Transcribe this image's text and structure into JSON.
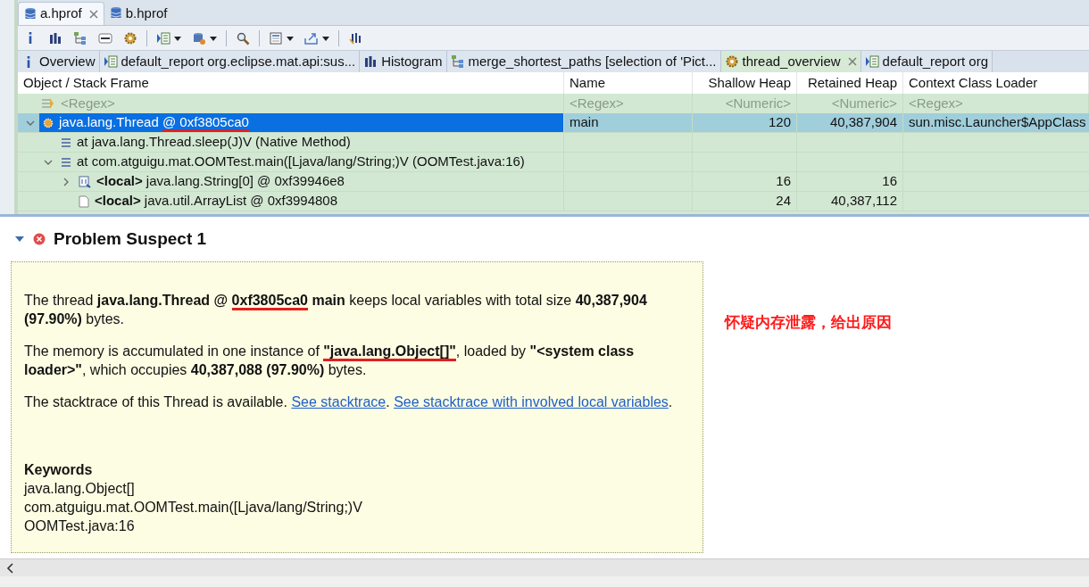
{
  "editor_tabs": [
    {
      "label": "a.hprof",
      "selected": true,
      "closable": true
    },
    {
      "label": "b.hprof",
      "selected": false,
      "closable": false
    }
  ],
  "toolbar": [
    {
      "kind": "info",
      "dropdown": false
    },
    {
      "kind": "histogram",
      "dropdown": false
    },
    {
      "kind": "tree",
      "dropdown": false
    },
    {
      "kind": "oql",
      "dropdown": false
    },
    {
      "kind": "gear",
      "dropdown": false
    },
    {
      "kind": "separator"
    },
    {
      "kind": "report",
      "dropdown": true
    },
    {
      "kind": "heap",
      "dropdown": true
    },
    {
      "kind": "separator"
    },
    {
      "kind": "search",
      "dropdown": false
    },
    {
      "kind": "separator"
    },
    {
      "kind": "calc",
      "dropdown": true
    },
    {
      "kind": "export",
      "dropdown": true
    },
    {
      "kind": "separator"
    },
    {
      "kind": "pin",
      "dropdown": false
    }
  ],
  "view_tabs": [
    {
      "kind": "info",
      "label": "Overview",
      "selected": false,
      "closable": false
    },
    {
      "kind": "report",
      "label": "default_report  org.eclipse.mat.api:sus...",
      "selected": false,
      "closable": false
    },
    {
      "kind": "histogram",
      "label": "Histogram",
      "selected": false,
      "closable": false
    },
    {
      "kind": "tree",
      "label": "merge_shortest_paths  [selection of 'Pict...",
      "selected": false,
      "closable": false
    },
    {
      "kind": "gear",
      "label": "thread_overview",
      "selected": true,
      "closable": true
    },
    {
      "kind": "report",
      "label": "default_report  org",
      "selected": false,
      "closable": false
    }
  ],
  "table": {
    "columns": [
      "Object / Stack Frame",
      "Name",
      "Shallow Heap",
      "Retained Heap",
      "Context Class Loader"
    ],
    "filters": [
      "<Regex>",
      "<Regex>",
      "<Numeric>",
      "<Numeric>",
      "<Regex>"
    ],
    "rows": [
      {
        "kind": "thread",
        "expanded": true,
        "selected": true,
        "object": [
          {
            "text": "java.lang.Thread "
          },
          {
            "text": "@ 0xf3805ca0",
            "marked": true
          }
        ],
        "name": "main",
        "shallow": "120",
        "retained": "40,387,904",
        "loader": "sun.misc.Launcher$AppClass",
        "children": [
          {
            "kind": "frame",
            "object": [
              {
                "text": "at java.lang.Thread.sleep(J)V (Native Method)"
              }
            ]
          },
          {
            "kind": "frame",
            "expanded": true,
            "object": [
              {
                "text": "at com.atguigu.mat.OOMTest.main([Ljava/lang/String;)V (OOMTest.java:16)"
              }
            ],
            "children": [
              {
                "kind": "array",
                "expanded": false,
                "object": [
                  {
                    "text": "<local>",
                    "bold": true
                  },
                  {
                    "text": " java.lang.String[0] @ 0xf39946e8"
                  }
                ],
                "shallow": "16",
                "retained": "16"
              },
              {
                "kind": "object",
                "object": [
                  {
                    "text": "<local>",
                    "bold": true
                  },
                  {
                    "text": " java.util.ArrayList @ 0xf3994808"
                  }
                ],
                "shallow": "24",
                "retained": "40,387,112"
              }
            ]
          }
        ]
      }
    ]
  },
  "suspect": {
    "title": "Problem Suspect 1",
    "expanded": true,
    "paragraphs": [
      [
        {
          "text": "The thread "
        },
        {
          "text": "java.lang.Thread @ ",
          "bold": true
        },
        {
          "text": "0xf3805ca0",
          "bold": true,
          "marked": true
        },
        {
          "text": " main",
          "bold": true
        },
        {
          "text": " keeps local variables with total size "
        },
        {
          "text": "40,387,904 (97.90%)",
          "bold": true
        },
        {
          "text": " bytes."
        }
      ],
      [
        {
          "text": "The memory is accumulated in one instance of "
        },
        {
          "text": "\"java.lang.Object[]\"",
          "bold": true,
          "marked": true
        },
        {
          "text": ", loaded by "
        },
        {
          "text": "\"<system class loader>\"",
          "bold": true
        },
        {
          "text": ", which occupies "
        },
        {
          "text": "40,387,088 (97.90%)",
          "bold": true
        },
        {
          "text": " bytes."
        }
      ],
      [
        {
          "text": "The stacktrace of this Thread is available. "
        },
        {
          "text": "See stacktrace",
          "link": true,
          "suffix": ". "
        },
        {
          "text": "See stacktrace with involved local variables",
          "link": true,
          "suffix": "."
        }
      ]
    ],
    "keywords_title": "Keywords",
    "keywords": [
      "java.lang.Object[]",
      "com.atguigu.mat.OOMTest.main([Ljava/lang/String;)V",
      "OOMTest.java:16"
    ]
  },
  "annotation": "怀疑内存泄露，给出原因"
}
